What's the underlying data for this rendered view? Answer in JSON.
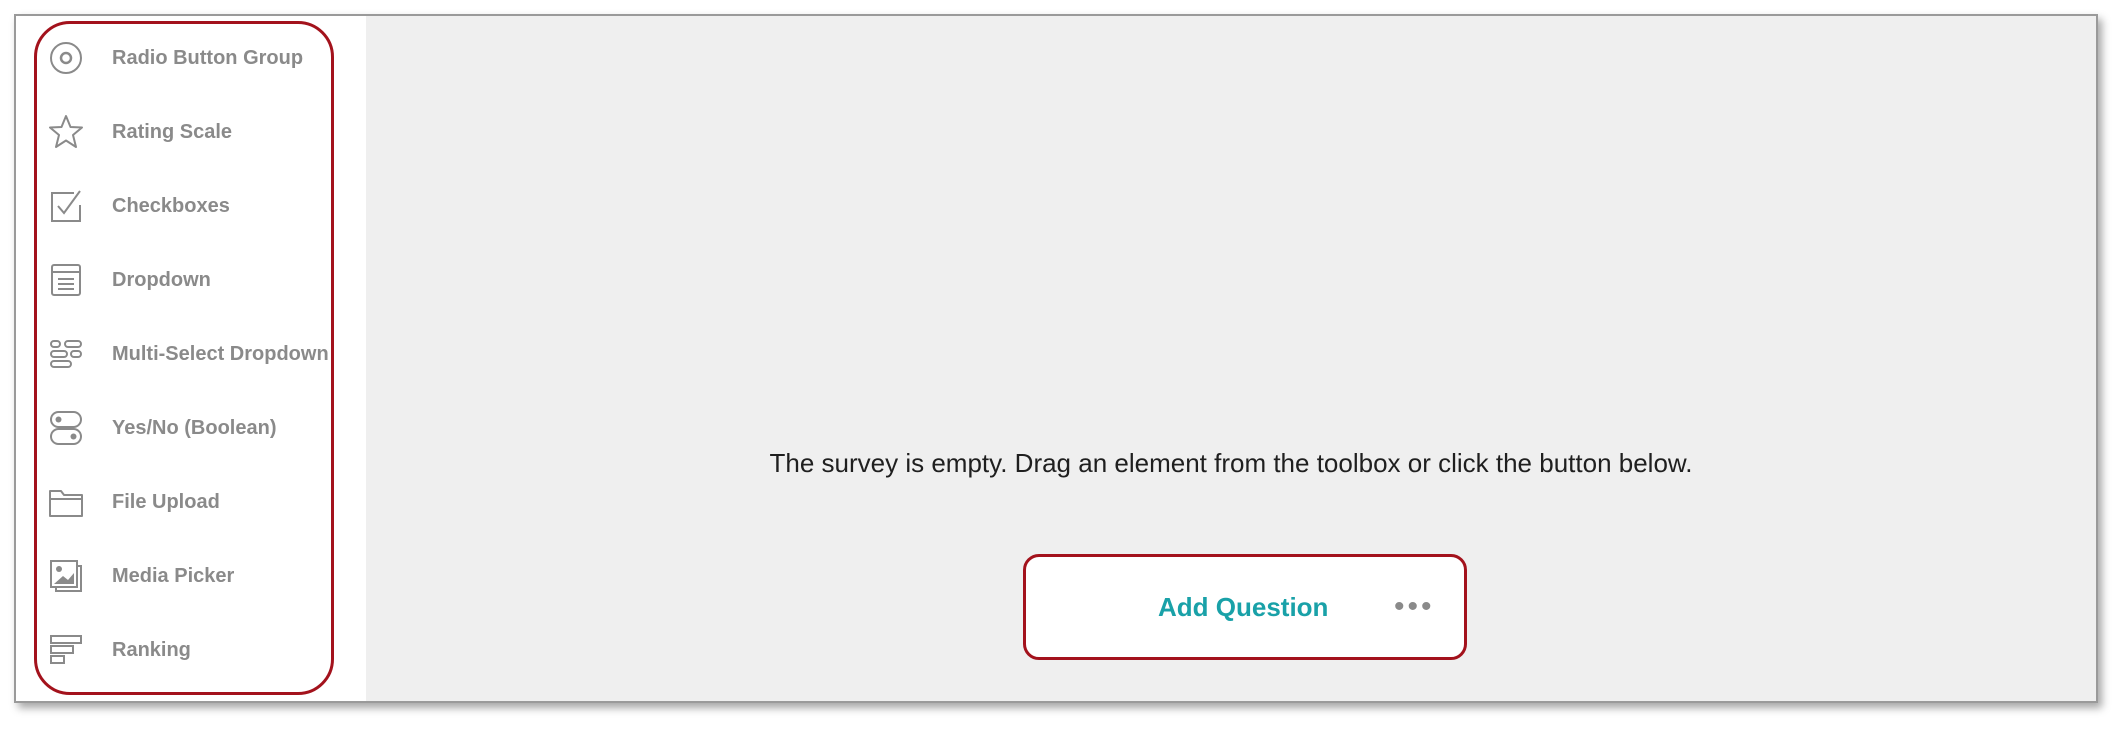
{
  "toolbox": {
    "items": [
      {
        "label": "Radio Button Group",
        "icon": "radio-icon"
      },
      {
        "label": "Rating Scale",
        "icon": "star-icon"
      },
      {
        "label": "Checkboxes",
        "icon": "checkbox-icon"
      },
      {
        "label": "Dropdown",
        "icon": "dropdown-icon"
      },
      {
        "label": "Multi-Select Dropdown",
        "icon": "multiselect-icon"
      },
      {
        "label": "Yes/No (Boolean)",
        "icon": "toggle-icon"
      },
      {
        "label": "File Upload",
        "icon": "folder-icon"
      },
      {
        "label": "Media Picker",
        "icon": "image-icon"
      },
      {
        "label": "Ranking",
        "icon": "ranking-icon"
      }
    ]
  },
  "canvas": {
    "empty_message": "The survey is empty. Drag an element from the toolbox or click the button below.",
    "add_question_label": "Add Question",
    "more_label": "•••"
  },
  "colors": {
    "accent": "#19a1a8",
    "highlight_outline": "#a3121c",
    "canvas_bg": "#efefef",
    "label_gray": "#8a8a8a"
  }
}
